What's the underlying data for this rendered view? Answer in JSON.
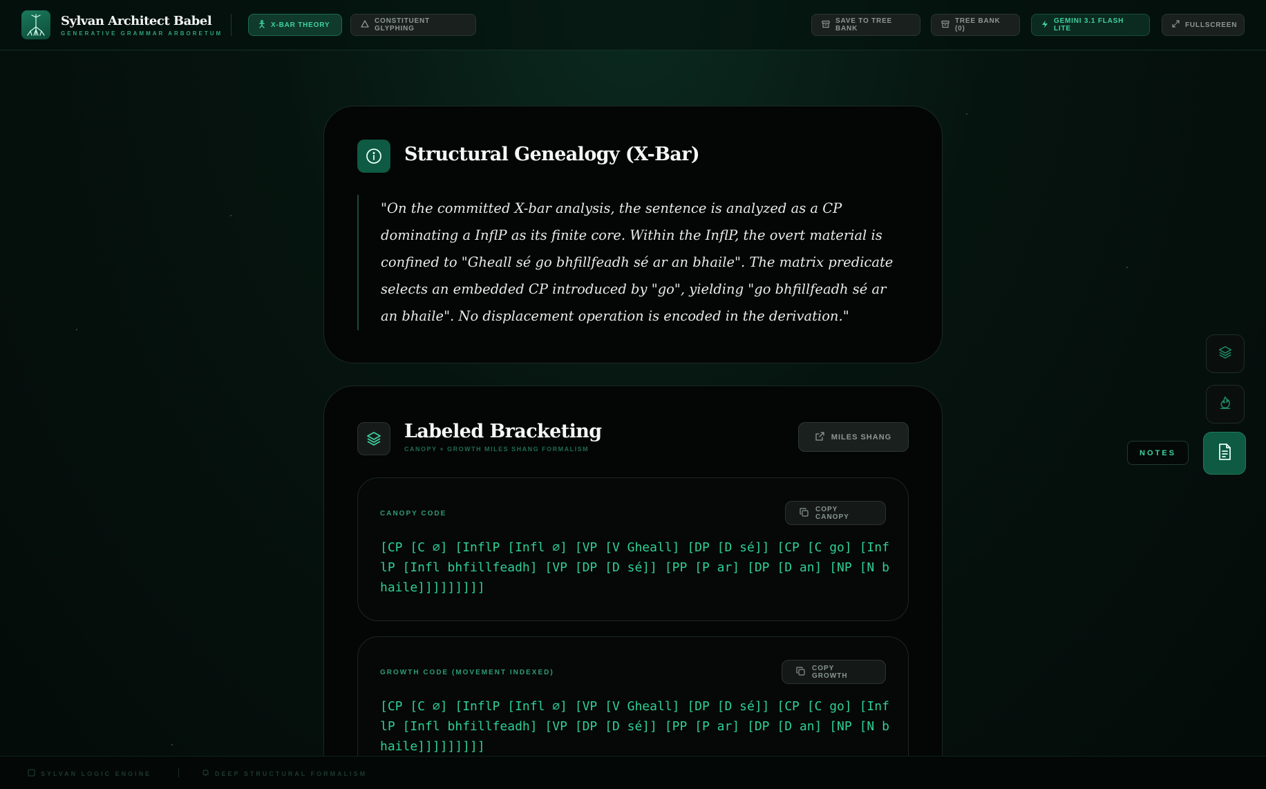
{
  "header": {
    "brand_title": "Sylvan Architect Babel",
    "brand_subtitle": "GENERATIVE GRAMMAR ARBORETUM",
    "tabs": [
      {
        "label": "X-BAR THEORY",
        "icon": "person-icon",
        "active": true
      },
      {
        "label": "CONSTITUENT GLYPHING",
        "icon": "triangle-icon",
        "active": false
      }
    ],
    "actions": {
      "save": "SAVE TO TREE BANK",
      "tree_bank": "TREE BANK (0)",
      "model": "GEMINI 3.1 FLASH LITE",
      "fullscreen": "FULLSCREEN"
    }
  },
  "genealogy": {
    "title": "Structural Genealogy (X-Bar)",
    "quote": "\"On the committed X-bar analysis, the sentence is analyzed as a CP dominating a InflP as its finite core. Within the InflP, the overt material is confined to \"Gheall sé go bhfillfeadh sé ar an bhaile\". The matrix predicate selects an embedded CP introduced by \"go\", yielding \"go bhfillfeadh sé ar an bhaile\". No displacement operation is encoded in the derivation.\""
  },
  "bracketing": {
    "title": "Labeled Bracketing",
    "subtitle": "CANOPY + GROWTH MILES SHANG FORMALISM",
    "miles_button": "MILES SHANG",
    "canopy": {
      "label": "CANOPY CODE",
      "copy_label": "COPY CANOPY",
      "code": "[CP [C ∅] [InflP [Infl ∅] [VP [V Gheall] [DP [D sé]] [CP [C go] [InflP [Infl bhfillfeadh] [VP [DP [D sé]] [PP [P ar] [DP [D an] [NP [N bhaile]]]]]]]]]"
    },
    "growth": {
      "label": "GROWTH CODE (MOVEMENT INDEXED)",
      "copy_label": "COPY GROWTH",
      "code": "[CP [C ∅] [InflP [Infl ∅] [VP [V Gheall] [DP [D sé]] [CP [C go] [InflP [Infl bhfillfeadh] [VP [DP [D sé]] [PP [P ar] [DP [D an] [NP [N bhaile]]]]]]]]]"
    }
  },
  "side_toolbar": {
    "notes_label": "NOTES",
    "buttons": [
      "layers-icon",
      "fire-icon",
      "document-icon"
    ]
  },
  "footer": {
    "left": "SYLVAN LOGIC ENGINE",
    "middle": "DEEP STRUCTURAL FORMALISM"
  },
  "colors": {
    "accent": "#3fd3a0",
    "code": "#2fcf96",
    "background": "#06140f"
  }
}
